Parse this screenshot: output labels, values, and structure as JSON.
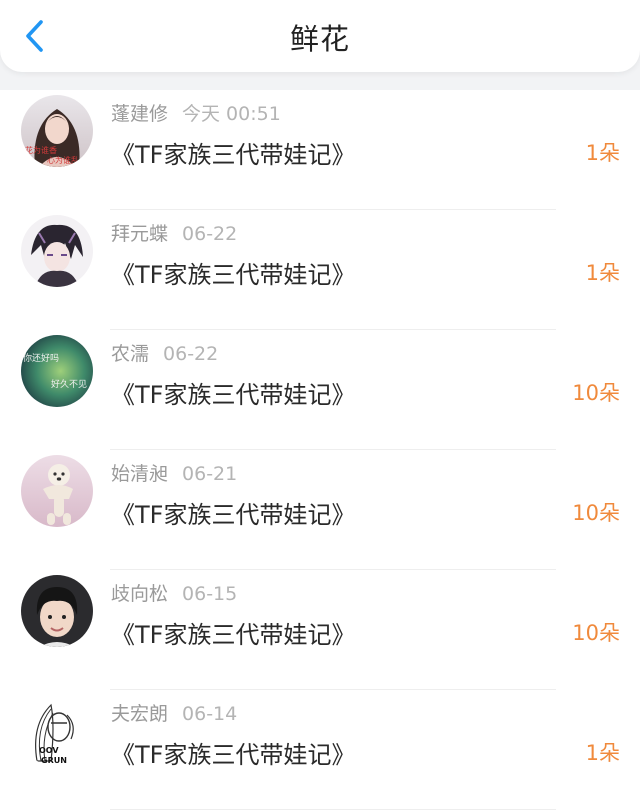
{
  "header": {
    "title": "鲜花",
    "back_icon": "chevron-left-icon",
    "accent_color": "#2196f3"
  },
  "colors": {
    "amount": "#f08a3c",
    "meta": "#9a9a9a",
    "title": "#2a2a2a"
  },
  "list": {
    "items": [
      {
        "user": "蓬建修",
        "time": "今天 00:51",
        "book": "《TF家族三代带娃记》",
        "amount": "1朵",
        "avatar_text": [
          "花为谁香",
          "心为谁乱"
        ]
      },
      {
        "user": "拜元蝶",
        "time": "06-22",
        "book": "《TF家族三代带娃记》",
        "amount": "1朵",
        "avatar_text": []
      },
      {
        "user": "农濡",
        "time": "06-22",
        "book": "《TF家族三代带娃记》",
        "amount": "10朵",
        "avatar_text": [
          "你还好吗",
          "好久不见"
        ]
      },
      {
        "user": "始清昶",
        "time": "06-21",
        "book": "《TF家族三代带娃记》",
        "amount": "10朵",
        "avatar_text": []
      },
      {
        "user": "歧向松",
        "time": "06-15",
        "book": "《TF家族三代带娃记》",
        "amount": "10朵",
        "avatar_text": []
      },
      {
        "user": "夫宏朗",
        "time": "06-14",
        "book": "《TF家族三代带娃记》",
        "amount": "1朵",
        "avatar_text": [
          "OOV",
          "GRUN"
        ]
      }
    ]
  }
}
